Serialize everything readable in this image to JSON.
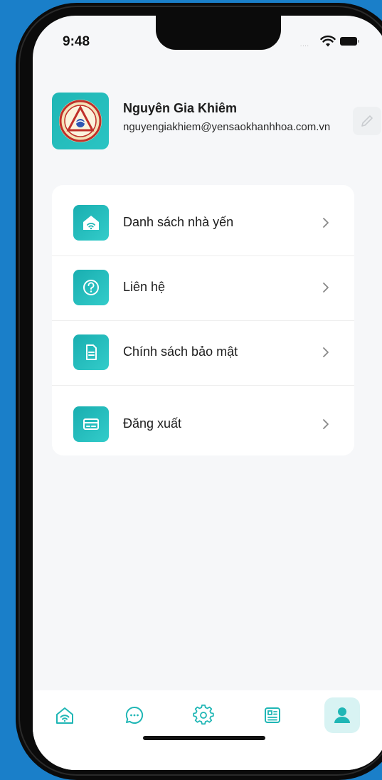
{
  "status_bar": {
    "time": "9:48",
    "signal_dots": "....",
    "wifi_icon": "wifi-icon",
    "battery_icon": "battery-icon"
  },
  "profile": {
    "name": "Nguyên Gia Khiêm",
    "email": "nguyengiakhiem@yensaokhanhhoa.com.vn",
    "avatar_icon": "company-logo",
    "edit_icon": "pencil-icon"
  },
  "menu": {
    "items": [
      {
        "label": "Danh sách nhà yến",
        "icon": "home-wifi-icon"
      },
      {
        "label": "Liên hệ",
        "icon": "question-icon"
      },
      {
        "label": "Chính sách bảo mật",
        "icon": "document-icon"
      },
      {
        "label": "Đăng xuất",
        "icon": "card-icon"
      }
    ]
  },
  "bottom_nav": {
    "items": [
      {
        "name": "home",
        "icon": "home-wifi-icon"
      },
      {
        "name": "chat",
        "icon": "chat-bubble-icon"
      },
      {
        "name": "settings",
        "icon": "gear-icon"
      },
      {
        "name": "news",
        "icon": "newspaper-icon"
      },
      {
        "name": "profile",
        "icon": "user-icon",
        "active": true
      }
    ]
  },
  "colors": {
    "background": "#1a7fc9",
    "accent": "#1fb6b5",
    "active_nav_bg": "#d8f3f3",
    "text_dark": "#1c1c1c",
    "chevron": "#888888"
  }
}
